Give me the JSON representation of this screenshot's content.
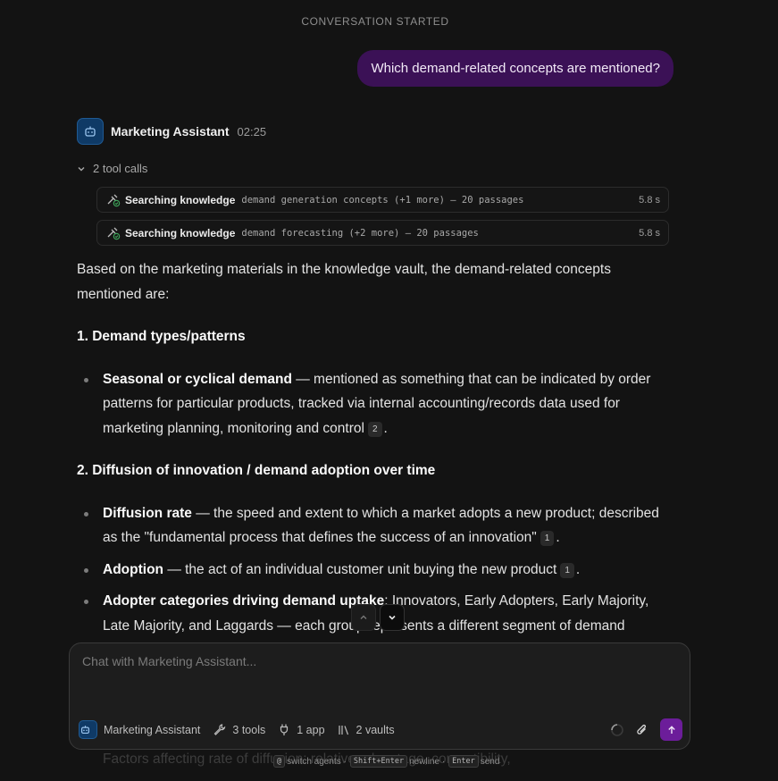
{
  "banner": "CONVERSATION STARTED",
  "user_message": "Which demand-related concepts are mentioned?",
  "agent": {
    "name": "Marketing Assistant",
    "time": "02:25"
  },
  "tool_calls": {
    "summary": "2 tool calls",
    "items": [
      {
        "title": "Searching knowledge",
        "detail": "demand generation concepts (+1 more) – 20 passages",
        "duration": "5.8 s"
      },
      {
        "title": "Searching knowledge",
        "detail": "demand forecasting (+2 more) – 20 passages",
        "duration": "5.8 s"
      }
    ]
  },
  "response": {
    "intro": "Based on the marketing materials in the knowledge vault, the demand-related concepts mentioned are:",
    "section1": {
      "heading": "1. Demand types/patterns",
      "items": [
        {
          "term": "Seasonal or cyclical demand",
          "text": " — mentioned as something that can be indicated by order patterns for particular products, tracked via internal accounting/records data used for marketing planning, monitoring and control",
          "cite": "2",
          "end": "."
        }
      ]
    },
    "section2": {
      "heading": "2. Diffusion of innovation / demand adoption over time",
      "items": [
        {
          "term": "Diffusion rate",
          "text": " — the speed and extent to which a market adopts a new product; described as the \"fundamental process that defines the success of an innovation\"",
          "cite": "1",
          "end": "."
        },
        {
          "term": "Adoption",
          "text": " — the act of an individual customer unit buying the new product",
          "cite": "1",
          "end": "."
        },
        {
          "term": "Adopter categories driving demand uptake",
          "text": ": Innovators, Early Adopters, Early Majority, Late Majority, and Laggards — each group represents a different segment of demand readiness over"
        }
      ]
    },
    "faded_line": "Factors affecting rate of diffusion: relative advantage, compatibility,"
  },
  "composer": {
    "placeholder": "Chat with Marketing Assistant...",
    "agent_chip": "Marketing Assistant",
    "tools_chip": "3 tools",
    "apps_chip": "1 app",
    "vaults_chip": "2 vaults"
  },
  "hint": {
    "key1": "@",
    "text1": "switch agents ·",
    "key2": "Shift+Enter",
    "text2": "newline ·",
    "key3": "Enter",
    "text3": "send"
  },
  "colors": {
    "user_bubble": "#3b1156",
    "send_button": "#6c1d9a",
    "avatar": "#0f3a66"
  }
}
